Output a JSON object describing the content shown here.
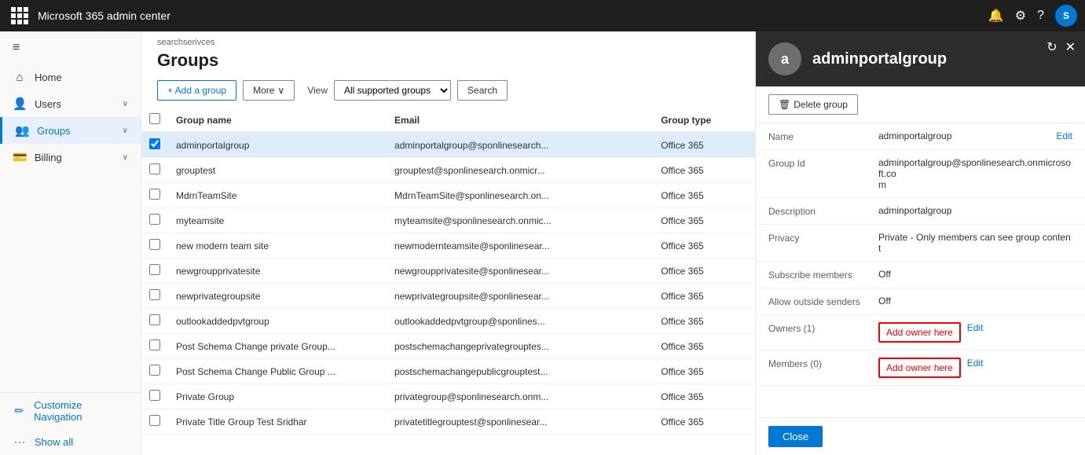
{
  "topbar": {
    "title": "Microsoft 365 admin center",
    "avatar_label": "S"
  },
  "sidebar": {
    "hamburger_icon": "≡",
    "items": [
      {
        "id": "home",
        "label": "Home",
        "icon": "⌂",
        "has_chevron": false
      },
      {
        "id": "users",
        "label": "Users",
        "icon": "👤",
        "has_chevron": true
      },
      {
        "id": "groups",
        "label": "Groups",
        "icon": "👥",
        "has_chevron": true,
        "active": true
      },
      {
        "id": "billing",
        "label": "Billing",
        "icon": "💳",
        "has_chevron": true
      }
    ],
    "bottom_items": [
      {
        "id": "customize",
        "label": "Customize Navigation",
        "icon": "✏️"
      },
      {
        "id": "showall",
        "label": "Show all",
        "icon": "···"
      }
    ]
  },
  "breadcrumb": "searchserivces",
  "page_title": "Groups",
  "toolbar": {
    "add_button": "+ Add a group",
    "more_button": "More",
    "view_label": "View",
    "view_options": [
      "All supported groups"
    ],
    "view_selected": "All supported groups",
    "search_button": "Search"
  },
  "table": {
    "columns": [
      "Group name",
      "Email",
      "Group type"
    ],
    "rows": [
      {
        "name": "adminportalgroup",
        "email": "adminportalgroup@sponlinesearch...",
        "type": "Office 365",
        "selected": true
      },
      {
        "name": "grouptest",
        "email": "grouptest@sponlinesearch.onmicr...",
        "type": "Office 365",
        "selected": false
      },
      {
        "name": "MdrnTeamSite",
        "email": "MdrnTeamSite@sponlinesearch.on...",
        "type": "Office 365",
        "selected": false
      },
      {
        "name": "myteamsite",
        "email": "myteamsite@sponlinesearch.onmic...",
        "type": "Office 365",
        "selected": false
      },
      {
        "name": "new modern team site",
        "email": "newmodernteamsite@sponlinesear...",
        "type": "Office 365",
        "selected": false
      },
      {
        "name": "newgroupprivatesite",
        "email": "newgroupprivatesite@sponlinesear...",
        "type": "Office 365",
        "selected": false
      },
      {
        "name": "newprivategroupsite",
        "email": "newprivategroupsite@sponlinesear...",
        "type": "Office 365",
        "selected": false
      },
      {
        "name": "outlookaddedpvtgroup",
        "email": "outlookaddedpvtgroup@sponlines...",
        "type": "Office 365",
        "selected": false
      },
      {
        "name": "Post Schema Change private Group...",
        "email": "postschemachangeprivategrouptes...",
        "type": "Office 365",
        "selected": false
      },
      {
        "name": "Post Schema Change Public Group ...",
        "email": "postschemachangepublicgrouptest...",
        "type": "Office 365",
        "selected": false
      },
      {
        "name": "Private Group",
        "email": "privategroup@sponlinesearch.onm...",
        "type": "Office 365",
        "selected": false
      },
      {
        "name": "Private Title Group Test Sridhar",
        "email": "privatetitlegrouptest@sponlinesear...",
        "type": "Office 365",
        "selected": false
      }
    ]
  },
  "detail": {
    "avatar_label": "a",
    "group_name": "adminportalgroup",
    "delete_button": "Delete group",
    "fields": [
      {
        "id": "name",
        "label": "Name",
        "value": "adminportalgroup",
        "editable": true,
        "edit_label": "Edit"
      },
      {
        "id": "group_id",
        "label": "Group Id",
        "value": "adminportalgroup@sponlinesearch.onmicrosoft.co\nm",
        "editable": false
      },
      {
        "id": "description",
        "label": "Description",
        "value": "adminportalgroup",
        "editable": false
      },
      {
        "id": "privacy",
        "label": "Privacy",
        "value": "Private - Only members can see group content",
        "editable": false
      },
      {
        "id": "subscribe_members",
        "label": "Subscribe members",
        "value": "Off",
        "editable": false
      },
      {
        "id": "allow_outside_senders",
        "label": "Allow outside senders",
        "value": "Off",
        "editable": false
      },
      {
        "id": "owners",
        "label": "Owners (1)",
        "value": "",
        "add_owner": true,
        "editable": true,
        "edit_label": "Edit"
      },
      {
        "id": "members",
        "label": "Members (0)",
        "value": "",
        "add_owner": true,
        "editable": true,
        "edit_label": "Edit"
      }
    ],
    "add_owner_label": "Add owner here",
    "close_button": "Close",
    "refresh_icon": "↻",
    "close_icon": "✕"
  }
}
